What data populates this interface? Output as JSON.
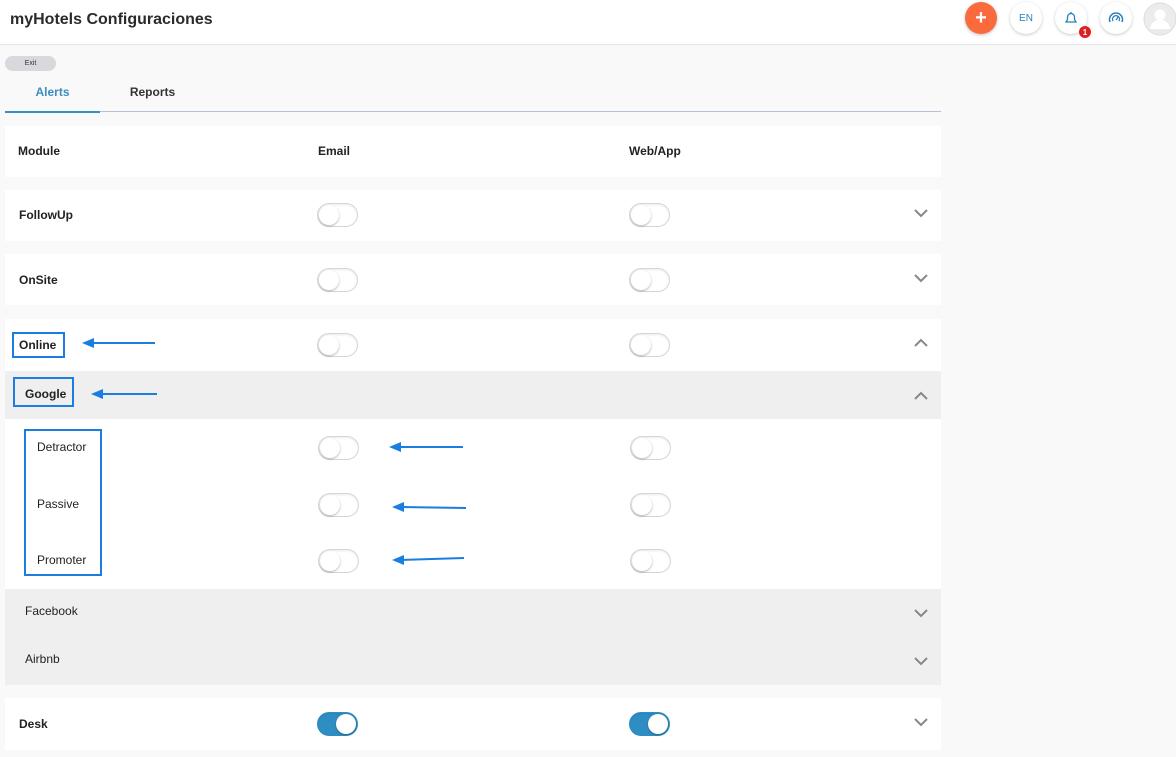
{
  "header": {
    "title": "myHotels Configuraciones",
    "add_label": "+",
    "lang": "EN",
    "notification_count": "1"
  },
  "exit_label": "Exit",
  "tabs": [
    {
      "label": "Alerts",
      "active": true
    },
    {
      "label": "Reports",
      "active": false
    }
  ],
  "table": {
    "headers": {
      "module": "Module",
      "email": "Email",
      "webapp": "Web/App"
    },
    "rows": {
      "followup": {
        "label": "FollowUp",
        "email": false,
        "webapp": false,
        "expanded": false
      },
      "onsite": {
        "label": "OnSite",
        "email": false,
        "webapp": false,
        "expanded": false
      },
      "online": {
        "label": "Online",
        "email": false,
        "webapp": false,
        "expanded": true
      },
      "desk": {
        "label": "Desk",
        "email": true,
        "webapp": true,
        "expanded": false
      }
    },
    "online_sources": {
      "google": {
        "label": "Google",
        "expanded": true
      },
      "facebook": {
        "label": "Facebook",
        "expanded": false
      },
      "airbnb": {
        "label": "Airbnb",
        "expanded": false
      }
    },
    "google_items": [
      {
        "label": "Detractor",
        "email": false,
        "webapp": false
      },
      {
        "label": "Passive",
        "email": false,
        "webapp": false
      },
      {
        "label": "Promoter",
        "email": false,
        "webapp": false
      }
    ]
  },
  "colors": {
    "accent": "#3b8ec2",
    "toggle_on": "#2e8ec4",
    "add_button": "#fa6a3c",
    "annotation": "#1a7de0",
    "badge": "#e02020"
  }
}
